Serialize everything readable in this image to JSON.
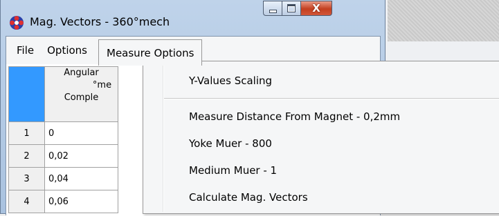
{
  "window": {
    "title": "Mag. Vectors - 360°mech",
    "controls": {
      "minimize": "minimize",
      "maximize": "maximize",
      "close": "X"
    }
  },
  "menubar": {
    "items": [
      {
        "label": "File"
      },
      {
        "label": "Options"
      },
      {
        "label": "Measure Options"
      }
    ]
  },
  "grid": {
    "header": {
      "line1": "Angular",
      "line2": "°me",
      "line3": "Comple"
    },
    "rows": [
      {
        "num": "1",
        "value": "0"
      },
      {
        "num": "2",
        "value": "0,02"
      },
      {
        "num": "3",
        "value": "0,04"
      },
      {
        "num": "4",
        "value": "0,06"
      }
    ]
  },
  "dropdown": {
    "items": [
      {
        "label": "Y-Values Scaling"
      },
      {
        "label": "Measure Distance From Magnet - 0,2mm"
      },
      {
        "label": "Yoke Muer - 800"
      },
      {
        "label": "Medium Muer - 1"
      },
      {
        "label": "Calculate Mag. Vectors"
      }
    ]
  },
  "colors": {
    "selection": "#3399ff",
    "titlebar": "#bfd3ea",
    "close_button": "#c33f1f"
  },
  "icons": [
    "app-icon",
    "minimize-icon",
    "maximize-icon",
    "close-icon"
  ]
}
